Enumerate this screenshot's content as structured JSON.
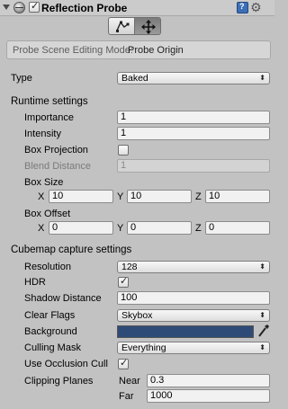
{
  "header": {
    "title": "Reflection Probe",
    "enabled": true
  },
  "mode": {
    "label": "Probe Scene Editing Mode:",
    "value": "Probe Origin"
  },
  "type": {
    "label": "Type",
    "value": "Baked"
  },
  "runtime": {
    "section_label": "Runtime settings",
    "importance_label": "Importance",
    "importance_value": "1",
    "intensity_label": "Intensity",
    "intensity_value": "1",
    "box_projection_label": "Box Projection",
    "box_projection_checked": false,
    "blend_distance_label": "Blend Distance",
    "blend_distance_value": "1",
    "box_size_label": "Box Size",
    "box_size": {
      "x_label": "X",
      "x": "10",
      "y_label": "Y",
      "y": "10",
      "z_label": "Z",
      "z": "10"
    },
    "box_offset_label": "Box Offset",
    "box_offset": {
      "x_label": "X",
      "x": "0",
      "y_label": "Y",
      "y": "0",
      "z_label": "Z",
      "z": "0"
    }
  },
  "cubemap": {
    "section_label": "Cubemap capture settings",
    "resolution_label": "Resolution",
    "resolution_value": "128",
    "hdr_label": "HDR",
    "hdr_checked": true,
    "shadow_distance_label": "Shadow Distance",
    "shadow_distance_value": "100",
    "clear_flags_label": "Clear Flags",
    "clear_flags_value": "Skybox",
    "background_label": "Background",
    "background_color": "#2e4b78",
    "culling_mask_label": "Culling Mask",
    "culling_mask_value": "Everything",
    "use_occlusion_label": "Use Occlusion Cull",
    "use_occlusion_checked": true,
    "clipping_planes_label": "Clipping Planes",
    "near_label": "Near",
    "near_value": "0.3",
    "far_label": "Far",
    "far_value": "1000"
  },
  "icons": {
    "fold": "chevron-down-icon",
    "component": "reflection-probe-icon",
    "help": "help-book-icon",
    "settings": "gear-icon",
    "edit_bounds": "edit-bounds-icon",
    "move_origin": "move-origin-icon",
    "color_picker": "eyedropper-icon"
  }
}
